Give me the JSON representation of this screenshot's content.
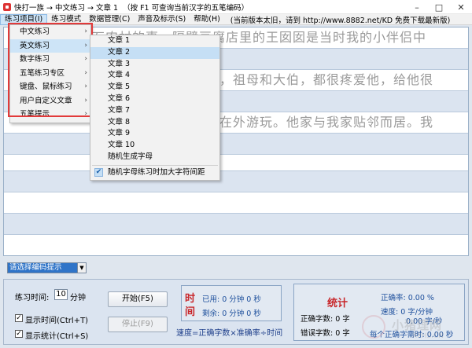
{
  "window": {
    "title": "快打一族 → 中文练习 → 文章 1",
    "hint": "（按 F1 可查询当前汉字的五笔编码）"
  },
  "menubar": {
    "items": [
      "练习项目(I)",
      "练习模式",
      "数据管理(C)",
      "声音及标示(S)",
      "帮助(H)"
    ],
    "info": "(当前版本太旧，请到 http://www.8882.net/KD 免费下载最新版)"
  },
  "practice_lines": [
    "石农村的事。隔壁豆腐店里的王囡囡是当时我的小伴侣中",
    "，祖母和大伯，都很疼爱他，给他很",
    "在外游玩。他家与我家贴邻而居。我"
  ],
  "main_menu": {
    "items": [
      {
        "label": "中文练习",
        "arrow": "›"
      },
      {
        "label": "英文练习",
        "arrow": "›"
      },
      {
        "label": "数字练习",
        "arrow": "›"
      },
      {
        "label": "五笔练习专区",
        "arrow": "›"
      },
      {
        "label": "键盘、鼠标练习",
        "arrow": "›"
      },
      {
        "label": "用户自定义文章",
        "arrow": "›"
      },
      {
        "label": "五笔提示",
        "arrow": "›"
      }
    ]
  },
  "sub_menu": {
    "items": [
      "文章 1",
      "文章 2",
      "文章 3",
      "文章 4",
      "文章 5",
      "文章 6",
      "文章 7",
      "文章 8",
      "文章 9",
      "文章 10",
      "随机生成字母"
    ],
    "checked_item": "随机字母练习时加大字符间距",
    "check_mark": "✔"
  },
  "encoding_select": {
    "value": "请选择编码提示",
    "arrow": "▼"
  },
  "controls": {
    "time_label": "练习时间:",
    "time_value": "10",
    "time_unit": "分钟",
    "show_time": "显示时间(Ctrl+T)",
    "show_stats": "显示统计(Ctrl+S)",
    "check": "✓",
    "start": "开始(F5)",
    "stop": "停止(F9)"
  },
  "time_panel": {
    "title_1": "时",
    "title_2": "间",
    "used": "已用: 0 分钟 0 秒",
    "remaining": "剩余: 0 分钟 0 秒"
  },
  "stats_panel": {
    "title": "统计",
    "correct_count": "正确字数: 0 字",
    "wrong_count": "错误字数: 0 字",
    "accuracy": "正确率: 0.00 %",
    "speed": "速度: 0 字/分钟",
    "speed_2": "0.00 字/秒",
    "per_char": "每个正确字需时: 0.00 秒"
  },
  "formula": "速度=正确字数×准确率÷时间",
  "watermark": {
    "text": "小猪理网",
    "sub": "XPHS.CN"
  },
  "colors": {
    "accent": "#2f74c8",
    "highlight": "#cde4f7",
    "red": "#c8262a",
    "outline": "#e23a3a"
  }
}
